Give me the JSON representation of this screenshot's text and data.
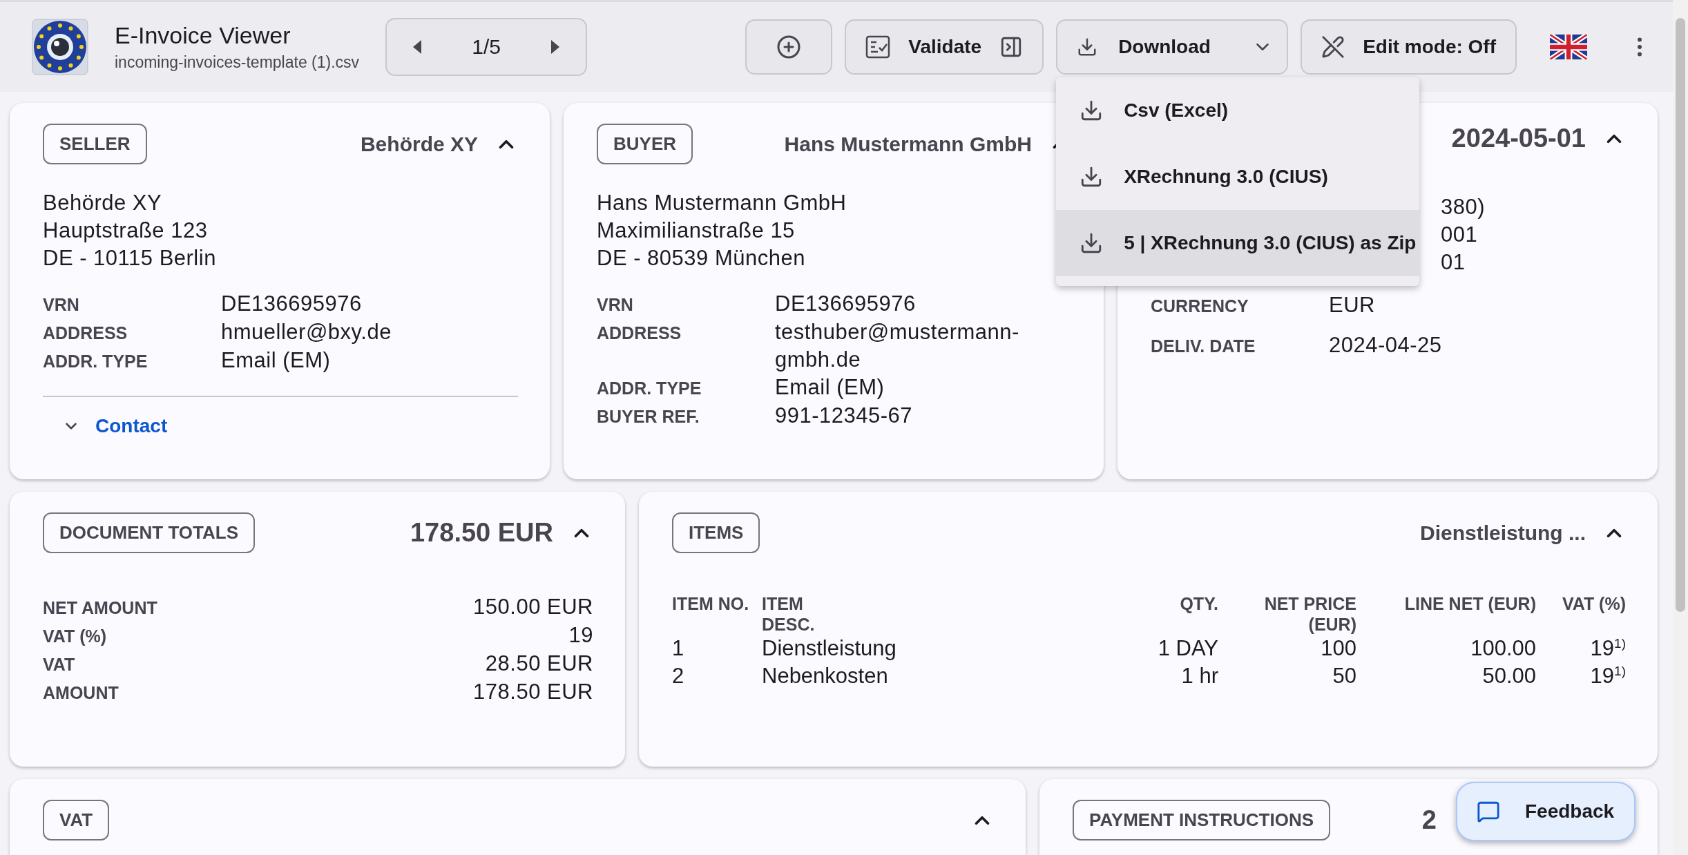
{
  "app": {
    "title": "E-Invoice Viewer",
    "file": "incoming-invoices-template (1).csv"
  },
  "nav": {
    "position": "1/5"
  },
  "toolbar": {
    "validate": "Validate",
    "download": "Download",
    "edit_mode": "Edit mode: Off"
  },
  "download_menu": {
    "open": true,
    "items": [
      {
        "label": "Csv (Excel)",
        "selected": false
      },
      {
        "label": "XRechnung 3.0 (CIUS)",
        "selected": false
      },
      {
        "label": "5 | XRechnung 3.0 (CIUS) as Zip",
        "selected": true
      }
    ]
  },
  "seller": {
    "heading": "SELLER",
    "summary": "Behörde XY",
    "expanded": true,
    "address_lines": [
      "Behörde XY",
      "Hauptstraße 123",
      "DE - 10115 Berlin"
    ],
    "fields": [
      {
        "label": "VRN",
        "value": "DE136695976"
      },
      {
        "label": "ADDRESS",
        "value": "hmueller@bxy.de"
      },
      {
        "label": "ADDR. TYPE",
        "value": "Email (EM)"
      }
    ],
    "contact": {
      "label": "Contact",
      "expanded": false
    }
  },
  "buyer": {
    "heading": "BUYER",
    "summary": "Hans Mustermann GmbH",
    "expanded": true,
    "address_lines": [
      "Hans Mustermann GmbH",
      "Maximilianstraße 15",
      "DE - 80539 München"
    ],
    "fields": [
      {
        "label": "VRN",
        "value": "DE136695976"
      },
      {
        "label": "ADDRESS",
        "value": "testhuber@mustermann-gmbh.de"
      },
      {
        "label": "ADDR. TYPE",
        "value": "Email (EM)"
      },
      {
        "label": "BUYER REF.",
        "value": "991-12345-67"
      }
    ]
  },
  "invoice": {
    "summary": "2024-05-01",
    "expanded": true,
    "partial_values": [
      "380)",
      "001",
      "01"
    ],
    "fields": [
      {
        "label": "CURRENCY",
        "value": "EUR"
      },
      {
        "label": "DELIV. DATE",
        "value": "2024-04-25"
      }
    ]
  },
  "totals": {
    "heading": "DOCUMENT TOTALS",
    "summary": "178.50 EUR",
    "expanded": true,
    "fields": [
      {
        "label": "NET AMOUNT",
        "value": "150.00 EUR"
      },
      {
        "label": "VAT (%)",
        "value": "19"
      },
      {
        "label": "VAT",
        "value": "28.50 EUR"
      },
      {
        "label": "AMOUNT",
        "value": "178.50 EUR"
      }
    ]
  },
  "items": {
    "heading": "ITEMS",
    "summary": "Dienstleistung ...",
    "expanded": true,
    "columns": [
      "ITEM NO.",
      "ITEM DESC.",
      "QTY.",
      "NET PRICE (EUR)",
      "LINE NET (EUR)",
      "VAT (%)"
    ],
    "rows": [
      [
        "1",
        "Dienstleistung",
        "1 DAY",
        "100",
        "100.00",
        "19$^{1)}$"
      ],
      [
        "2",
        "Nebenkosten",
        "1 hr",
        "50",
        "50.00",
        "19$^{1)}$"
      ]
    ]
  },
  "vat": {
    "heading": "VAT",
    "expanded": true
  },
  "payment": {
    "heading": "PAYMENT INSTRUCTIONS",
    "summary": "2"
  },
  "feedback": "Feedback"
}
